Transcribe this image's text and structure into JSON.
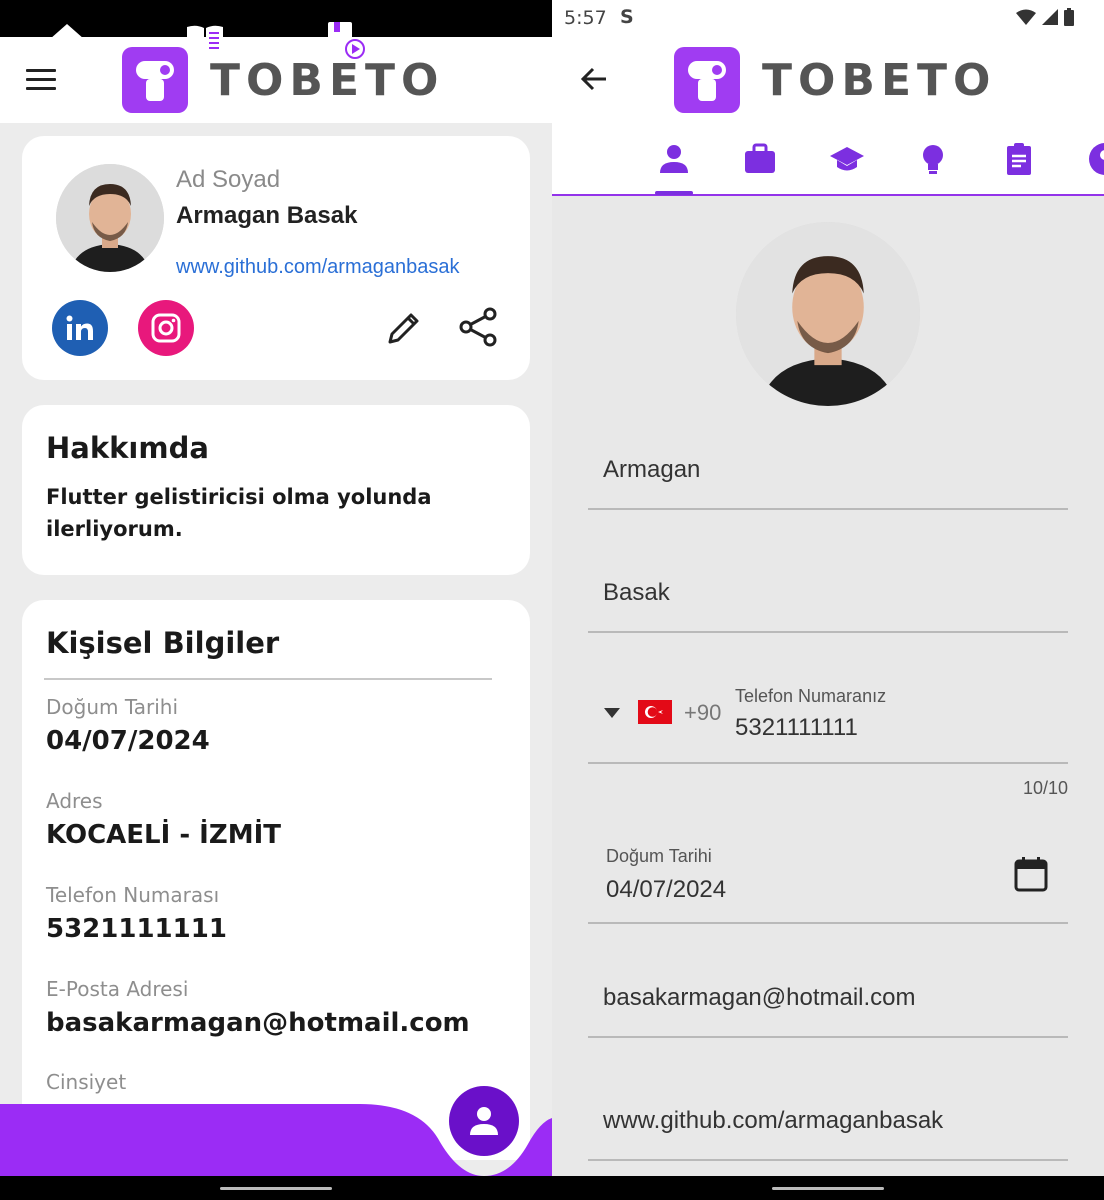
{
  "brand": {
    "name": "TOBETO",
    "color": "#a03cf2"
  },
  "left": {
    "profile": {
      "name_label": "Ad Soyad",
      "name": "Armagan Basak",
      "github": "www.github.com/armaganbasak",
      "social": [
        "linkedin-icon",
        "instagram-icon"
      ],
      "actions": [
        "edit-icon",
        "share-icon"
      ]
    },
    "about": {
      "title": "Hakkımda",
      "text": "Flutter gelistiricisi olma yolunda ilerliyorum."
    },
    "personal": {
      "title": "Kişisel Bilgiler",
      "fields": [
        {
          "label": "Doğum Tarihi",
          "value": "04/07/2024"
        },
        {
          "label": "Adres",
          "value": "KOCAELİ - İZMİT"
        },
        {
          "label": "Telefon Numarası",
          "value": "5321111111"
        },
        {
          "label": "E-Posta Adresi",
          "value": "basakarmagan@hotmail.com"
        },
        {
          "label": "Cinsiyet",
          "value": ""
        }
      ]
    },
    "bottom_nav": [
      "home-icon",
      "catalog-icon",
      "calendar-video-icon",
      "profile-icon"
    ]
  },
  "right": {
    "status": {
      "time": "5:57",
      "app_icon": "S"
    },
    "tabs": [
      "person-icon",
      "briefcase-icon",
      "graduation-cap-icon",
      "lightbulb-icon",
      "clipboard-icon",
      "account-circle-icon"
    ],
    "form": {
      "first_name": "Armagan",
      "last_name": "Basak",
      "phone": {
        "country_code": "+90",
        "label": "Telefon Numaranız",
        "value": "5321111111",
        "counter": "10/10"
      },
      "birth_date": {
        "label": "Doğum Tarihi",
        "value": "04/07/2024"
      },
      "email": "basakarmagan@hotmail.com",
      "github": "www.github.com/armaganbasak"
    }
  }
}
